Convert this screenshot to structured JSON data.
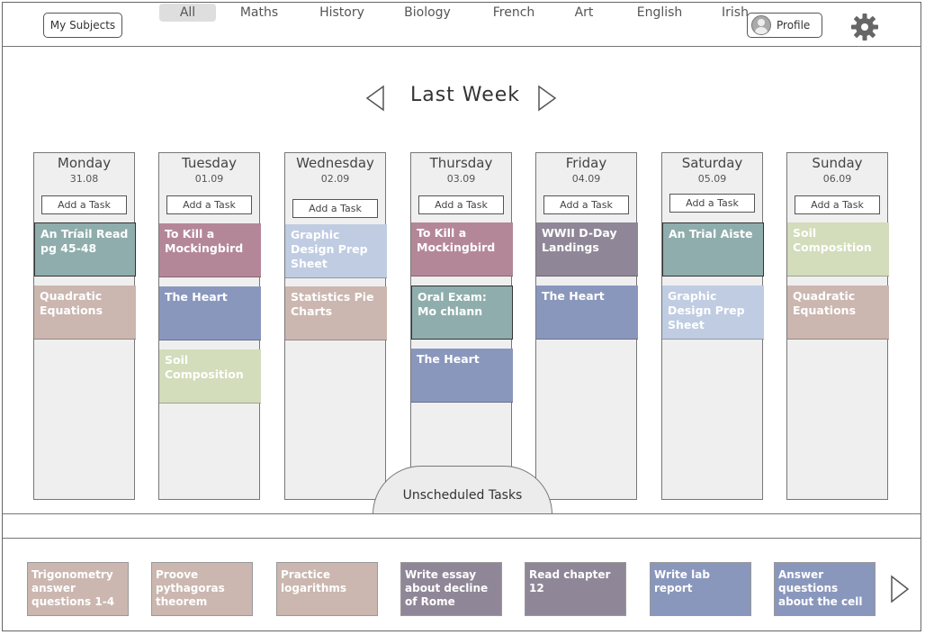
{
  "header": {
    "subjects_label": "My Subjects",
    "profile_label": "Profile",
    "settings_icon": "gear-icon"
  },
  "week": {
    "title": "Last Week"
  },
  "colors": {
    "teal": "#8fadad",
    "rose": "#b48798",
    "periwinkle": "#c0cce2",
    "tan": "#cbb7b0",
    "slate": "#8a97bd",
    "sage": "#d3dcbb",
    "mauve": "#8f8797"
  },
  "days": [
    {
      "name": "Monday",
      "date": "31.08",
      "add": "Add a Task",
      "tasks": [
        {
          "title": "An Tríail Read pg 45-48"
        },
        {
          "title": "Quadratic Equations"
        }
      ]
    },
    {
      "name": "Tuesday",
      "date": "01.09",
      "add": "Add a Task",
      "tasks": [
        {
          "title": "To Kill a Mockingbird"
        },
        {
          "title": "The Heart"
        },
        {
          "title": "Soil Composition"
        }
      ]
    },
    {
      "name": "Wednesday",
      "date": "02.09",
      "add": "Add a Task",
      "tasks": [
        {
          "title": "Graphic Design Prep Sheet"
        },
        {
          "title": "Statistics Pie Charts"
        }
      ]
    },
    {
      "name": "Thursday",
      "date": "03.09",
      "add": "Add a Task",
      "tasks": [
        {
          "title": "To Kill a Mockingbird"
        },
        {
          "title": "Oral Exam: Mo chlann"
        },
        {
          "title": "The Heart"
        }
      ]
    },
    {
      "name": "Friday",
      "date": "04.09",
      "add": "Add a Task",
      "tasks": [
        {
          "title": "WWII D-Day Landings"
        },
        {
          "title": "The Heart"
        }
      ]
    },
    {
      "name": "Saturday",
      "date": "05.09",
      "add": "Add a Task",
      "tasks": [
        {
          "title": "An Trial Aiste"
        },
        {
          "title": "Graphic Design Prep Sheet"
        }
      ]
    },
    {
      "name": "Sunday",
      "date": "06.09",
      "add": "Add a Task",
      "tasks": [
        {
          "title": "Soil Composition"
        },
        {
          "title": "Quadratic Equations"
        }
      ]
    }
  ],
  "unscheduled": {
    "label": "Unscheduled Tasks",
    "filters": [
      "All",
      "Maths",
      "History",
      "Biology",
      "French",
      "Art",
      "English",
      "Irish"
    ],
    "active_filter": "All",
    "tasks": [
      {
        "title": "Trigonometry answer questions 1-4"
      },
      {
        "title": "Proove pythagoras theorem"
      },
      {
        "title": "Practice logarithms"
      },
      {
        "title": "Write essay about decline of Rome"
      },
      {
        "title": "Read chapter 12"
      },
      {
        "title": "Write lab report"
      },
      {
        "title": "Answer questions about the cell"
      }
    ]
  }
}
